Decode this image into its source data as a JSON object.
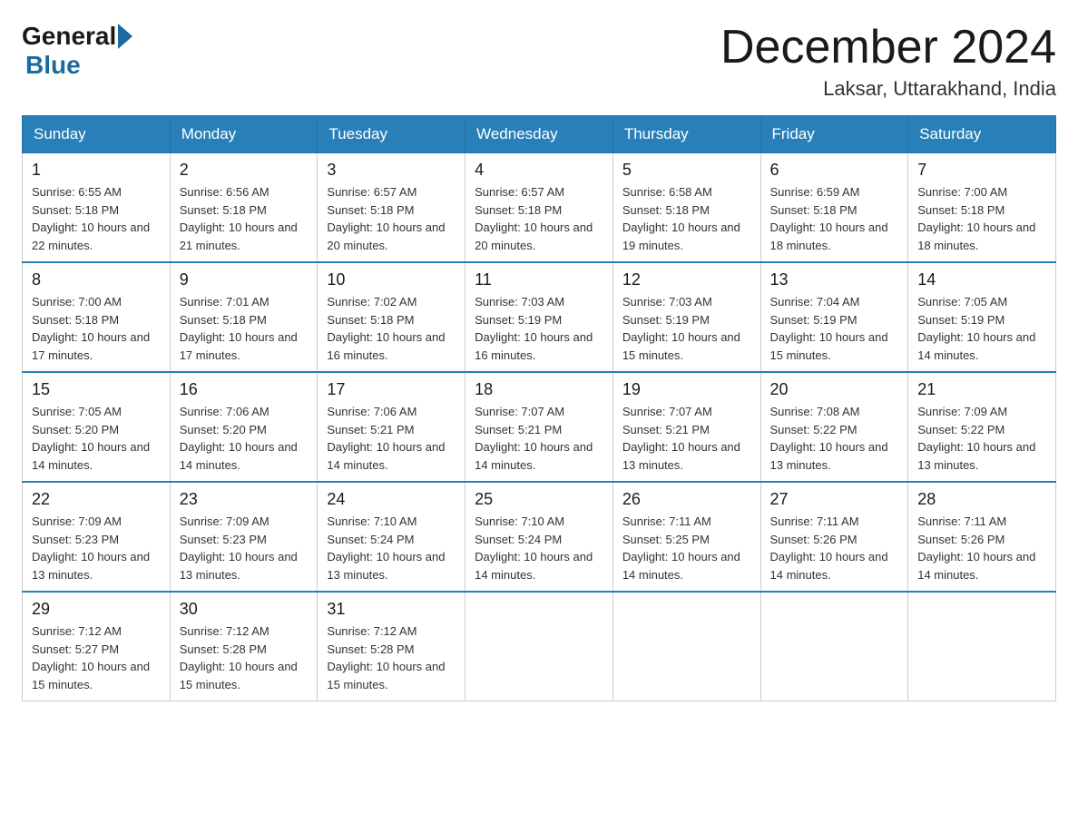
{
  "header": {
    "logo_general": "General",
    "logo_blue": "Blue",
    "month_title": "December 2024",
    "subtitle": "Laksar, Uttarakhand, India"
  },
  "days_of_week": [
    "Sunday",
    "Monday",
    "Tuesday",
    "Wednesday",
    "Thursday",
    "Friday",
    "Saturday"
  ],
  "weeks": [
    [
      {
        "day": "1",
        "sunrise": "6:55 AM",
        "sunset": "5:18 PM",
        "daylight": "10 hours and 22 minutes."
      },
      {
        "day": "2",
        "sunrise": "6:56 AM",
        "sunset": "5:18 PM",
        "daylight": "10 hours and 21 minutes."
      },
      {
        "day": "3",
        "sunrise": "6:57 AM",
        "sunset": "5:18 PM",
        "daylight": "10 hours and 20 minutes."
      },
      {
        "day": "4",
        "sunrise": "6:57 AM",
        "sunset": "5:18 PM",
        "daylight": "10 hours and 20 minutes."
      },
      {
        "day": "5",
        "sunrise": "6:58 AM",
        "sunset": "5:18 PM",
        "daylight": "10 hours and 19 minutes."
      },
      {
        "day": "6",
        "sunrise": "6:59 AM",
        "sunset": "5:18 PM",
        "daylight": "10 hours and 18 minutes."
      },
      {
        "day": "7",
        "sunrise": "7:00 AM",
        "sunset": "5:18 PM",
        "daylight": "10 hours and 18 minutes."
      }
    ],
    [
      {
        "day": "8",
        "sunrise": "7:00 AM",
        "sunset": "5:18 PM",
        "daylight": "10 hours and 17 minutes."
      },
      {
        "day": "9",
        "sunrise": "7:01 AM",
        "sunset": "5:18 PM",
        "daylight": "10 hours and 17 minutes."
      },
      {
        "day": "10",
        "sunrise": "7:02 AM",
        "sunset": "5:18 PM",
        "daylight": "10 hours and 16 minutes."
      },
      {
        "day": "11",
        "sunrise": "7:03 AM",
        "sunset": "5:19 PM",
        "daylight": "10 hours and 16 minutes."
      },
      {
        "day": "12",
        "sunrise": "7:03 AM",
        "sunset": "5:19 PM",
        "daylight": "10 hours and 15 minutes."
      },
      {
        "day": "13",
        "sunrise": "7:04 AM",
        "sunset": "5:19 PM",
        "daylight": "10 hours and 15 minutes."
      },
      {
        "day": "14",
        "sunrise": "7:05 AM",
        "sunset": "5:19 PM",
        "daylight": "10 hours and 14 minutes."
      }
    ],
    [
      {
        "day": "15",
        "sunrise": "7:05 AM",
        "sunset": "5:20 PM",
        "daylight": "10 hours and 14 minutes."
      },
      {
        "day": "16",
        "sunrise": "7:06 AM",
        "sunset": "5:20 PM",
        "daylight": "10 hours and 14 minutes."
      },
      {
        "day": "17",
        "sunrise": "7:06 AM",
        "sunset": "5:21 PM",
        "daylight": "10 hours and 14 minutes."
      },
      {
        "day": "18",
        "sunrise": "7:07 AM",
        "sunset": "5:21 PM",
        "daylight": "10 hours and 14 minutes."
      },
      {
        "day": "19",
        "sunrise": "7:07 AM",
        "sunset": "5:21 PM",
        "daylight": "10 hours and 13 minutes."
      },
      {
        "day": "20",
        "sunrise": "7:08 AM",
        "sunset": "5:22 PM",
        "daylight": "10 hours and 13 minutes."
      },
      {
        "day": "21",
        "sunrise": "7:09 AM",
        "sunset": "5:22 PM",
        "daylight": "10 hours and 13 minutes."
      }
    ],
    [
      {
        "day": "22",
        "sunrise": "7:09 AM",
        "sunset": "5:23 PM",
        "daylight": "10 hours and 13 minutes."
      },
      {
        "day": "23",
        "sunrise": "7:09 AM",
        "sunset": "5:23 PM",
        "daylight": "10 hours and 13 minutes."
      },
      {
        "day": "24",
        "sunrise": "7:10 AM",
        "sunset": "5:24 PM",
        "daylight": "10 hours and 13 minutes."
      },
      {
        "day": "25",
        "sunrise": "7:10 AM",
        "sunset": "5:24 PM",
        "daylight": "10 hours and 14 minutes."
      },
      {
        "day": "26",
        "sunrise": "7:11 AM",
        "sunset": "5:25 PM",
        "daylight": "10 hours and 14 minutes."
      },
      {
        "day": "27",
        "sunrise": "7:11 AM",
        "sunset": "5:26 PM",
        "daylight": "10 hours and 14 minutes."
      },
      {
        "day": "28",
        "sunrise": "7:11 AM",
        "sunset": "5:26 PM",
        "daylight": "10 hours and 14 minutes."
      }
    ],
    [
      {
        "day": "29",
        "sunrise": "7:12 AM",
        "sunset": "5:27 PM",
        "daylight": "10 hours and 15 minutes."
      },
      {
        "day": "30",
        "sunrise": "7:12 AM",
        "sunset": "5:28 PM",
        "daylight": "10 hours and 15 minutes."
      },
      {
        "day": "31",
        "sunrise": "7:12 AM",
        "sunset": "5:28 PM",
        "daylight": "10 hours and 15 minutes."
      },
      null,
      null,
      null,
      null
    ]
  ],
  "labels": {
    "sunrise": "Sunrise:",
    "sunset": "Sunset:",
    "daylight": "Daylight:"
  }
}
